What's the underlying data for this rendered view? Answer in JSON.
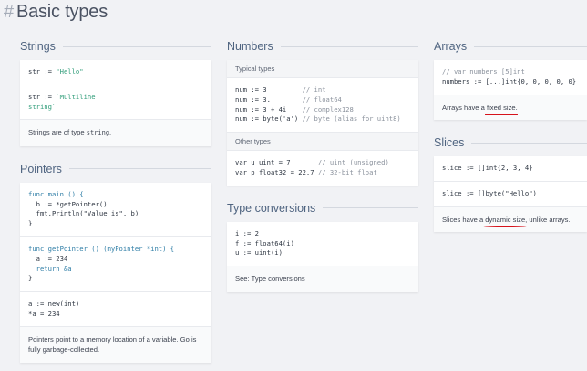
{
  "heading": {
    "hash": "#",
    "title": "Basic types"
  },
  "colors": {
    "highlight": "#d6121b",
    "title": "#4f6480",
    "string": "#2e9c78"
  },
  "strings": {
    "title": "Strings",
    "line1": [
      "str := ",
      "\"Hello\""
    ],
    "line2a": [
      "str := ",
      "`Multiline"
    ],
    "line2b": "string`",
    "note_pre": "Strings are of type ",
    "note_code": "string",
    "note_post": "."
  },
  "pointers": {
    "title": "Pointers",
    "b1": [
      "func main () {",
      "  b := *getPointer()",
      "  fmt.Println(\"Value is\", b)",
      "}"
    ],
    "b2": [
      "func getPointer () (myPointer *int) {",
      "  a := 234",
      "  return &a",
      "}"
    ],
    "b3": [
      "a := new(int)",
      "*a = 234"
    ],
    "note": "Pointers point to a memory location of a variable. Go is fully garbage-collected."
  },
  "numbers": {
    "title": "Numbers",
    "typical_label": "Typical types",
    "typical": [
      {
        "code": "num := 3",
        "comment": "// int"
      },
      {
        "code": "num := 3.",
        "comment": "// float64"
      },
      {
        "code": "num := 3 + 4i",
        "comment": "// complex128"
      },
      {
        "code": "num := byte('a')",
        "comment": "// byte (alias for uint8)"
      }
    ],
    "other_label": "Other types",
    "other": [
      {
        "code": "var u uint = 7",
        "comment": "// uint (unsigned)"
      },
      {
        "code": "var p float32 = 22.7",
        "comment": "// 32-bit float"
      }
    ]
  },
  "conversions": {
    "title": "Type conversions",
    "lines": [
      "i := 2",
      "f := float64(i)",
      "u := uint(i)"
    ],
    "note": "See: Type conversions"
  },
  "arrays": {
    "title": "Arrays",
    "comment": "// var numbers [5]int",
    "code": "numbers := [...]int{0, 0, 0, 0, 0}",
    "note_pre": "Arrays have a ",
    "note_hl": "fixed size",
    "note_post": "."
  },
  "slices": {
    "title": "Slices",
    "code1": "slice := []int{2, 3, 4}",
    "code2": "slice := []byte(\"Hello\")",
    "note_pre": "Slices have a ",
    "note_hl": "dynamic size",
    "note_post": ", unlike arrays."
  }
}
